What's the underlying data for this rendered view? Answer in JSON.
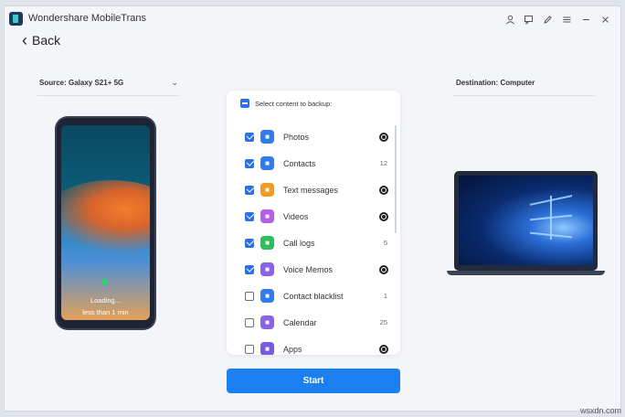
{
  "app": {
    "title": "Wondershare MobileTrans",
    "controls": [
      "user-icon",
      "feedback-icon",
      "edit-icon",
      "menu-icon",
      "minimize-icon",
      "close-icon"
    ]
  },
  "nav": {
    "back_label": "Back"
  },
  "source": {
    "label": "Source: Galaxy S21+ 5G"
  },
  "destination": {
    "label": "Destination: Computer"
  },
  "phone": {
    "loading_text": "Loading...",
    "time_text": "less than 1 min"
  },
  "content": {
    "select_all_label": "Select content to backup:",
    "items": [
      {
        "label": "Photos",
        "checked": true,
        "value": "",
        "status": "loading",
        "icon": "photos-icon",
        "color": "#2f7bf0"
      },
      {
        "label": "Contacts",
        "checked": true,
        "value": "12",
        "status": "count",
        "icon": "contacts-icon",
        "color": "#2f7bf0"
      },
      {
        "label": "Text messages",
        "checked": true,
        "value": "",
        "status": "loading",
        "icon": "messages-icon",
        "color": "#f59a23"
      },
      {
        "label": "Videos",
        "checked": true,
        "value": "",
        "status": "loading",
        "icon": "videos-icon",
        "color": "#b55ee8"
      },
      {
        "label": "Call logs",
        "checked": true,
        "value": "5",
        "status": "count",
        "icon": "call-logs-icon",
        "color": "#2fbf5a"
      },
      {
        "label": "Voice Memos",
        "checked": true,
        "value": "",
        "status": "loading",
        "icon": "voice-memos-icon",
        "color": "#8a63e8"
      },
      {
        "label": "Contact blacklist",
        "checked": false,
        "value": "1",
        "status": "count",
        "icon": "contact-blacklist-icon",
        "color": "#2f7bf0"
      },
      {
        "label": "Calendar",
        "checked": false,
        "value": "25",
        "status": "count",
        "icon": "calendar-icon",
        "color": "#8a63e8"
      },
      {
        "label": "Apps",
        "checked": false,
        "value": "",
        "status": "loading",
        "icon": "apps-icon",
        "color": "#7a5be0"
      }
    ]
  },
  "actions": {
    "start_label": "Start"
  },
  "watermark": "wsxdn.com",
  "colors": {
    "accent": "#1a7ff0",
    "checkbox": "#2a70e6"
  }
}
